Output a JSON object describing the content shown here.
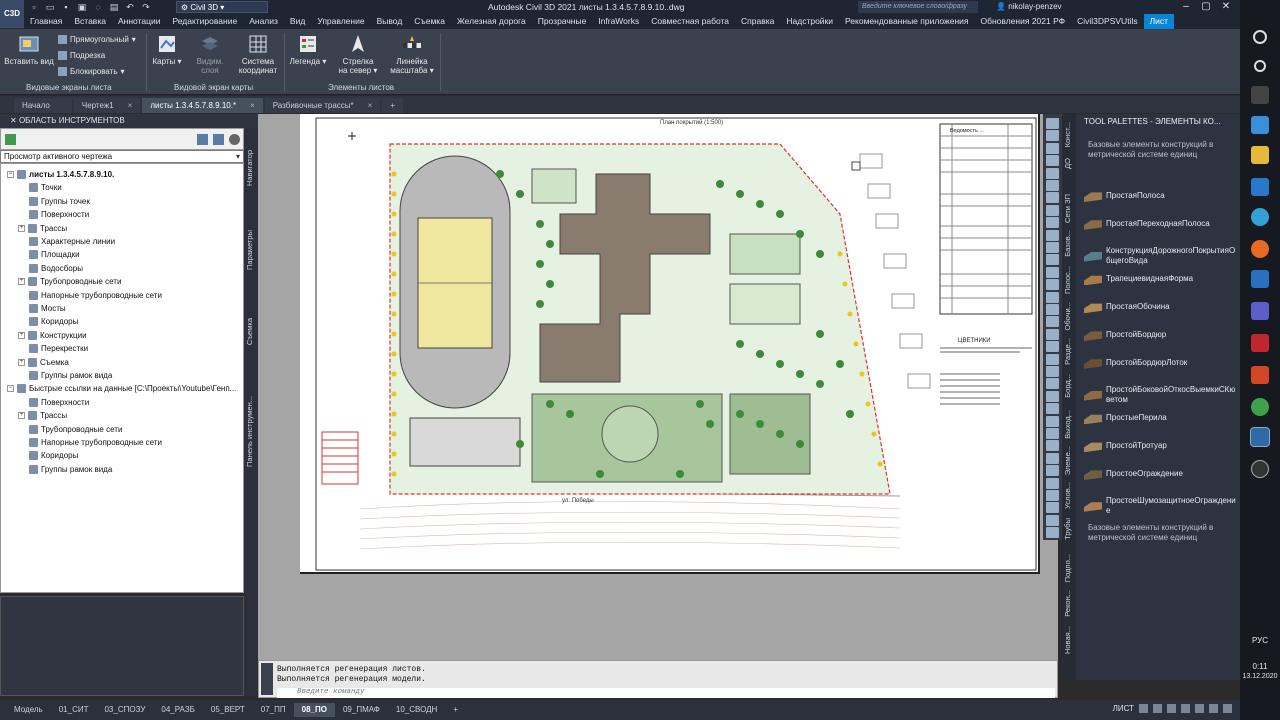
{
  "window": {
    "title": "Autodesk Civil 3D 2021   листы 1.3.4.5.7.8.9.10..dwg",
    "workspace": "Civil 3D",
    "search_placeholder": "Введите ключевое слово/фразу",
    "user": "nikolay-penzev",
    "logo": "C3D"
  },
  "menu": [
    "Главная",
    "Вставка",
    "Аннотации",
    "Редактирование",
    "Анализ",
    "Вид",
    "Управление",
    "Вывод",
    "Съемка",
    "Железная дорога",
    "Прозрачные",
    "InfraWorks",
    "Совместная работа",
    "Справка",
    "Надстройки",
    "Рекомендованные приложения",
    "Обновления 2021 РФ",
    "Civil3DPSVUtils",
    "Лист"
  ],
  "ribbon": {
    "insert_view": "Вставить вид",
    "rect": "Прямоугольный",
    "trim": "Подрезка",
    "lock": "Блокировать",
    "maps": "Карты",
    "visible_layers_1": "Видим.",
    "visible_layers_2": "слоя",
    "coord_sys_1": "Система",
    "coord_sys_2": "координат",
    "legend": "Легенда",
    "north_arrow_1": "Стрелка",
    "north_arrow_2": "на север",
    "scale_bar_1": "Линейка",
    "scale_bar_2": "масштаба",
    "panel_viewports": "Видовые экраны листа",
    "panel_map_viewport": "Видовой экран карты",
    "panel_sheet_elements": "Элементы листов"
  },
  "doc_tabs": [
    {
      "label": "Начало",
      "active": false,
      "close": ""
    },
    {
      "label": "Чертеж1",
      "active": false,
      "close": "×"
    },
    {
      "label": "листы 1.3.4.5.7.8.9.10.*",
      "active": true,
      "close": "×"
    },
    {
      "label": "Разбивочные трассы*",
      "active": false,
      "close": "×"
    }
  ],
  "toolspace": {
    "title": "ОБЛАСТЬ ИНСТРУМЕНТОВ",
    "view_select": "Просмотр активного чертежа",
    "tree": [
      {
        "label": "листы 1.3.4.5.7.8.9.10.",
        "level": 0,
        "exp": "−",
        "bold": true
      },
      {
        "label": "Точки",
        "level": 2,
        "exp": ""
      },
      {
        "label": "Группы точек",
        "level": 2,
        "exp": ""
      },
      {
        "label": "Поверхности",
        "level": 2,
        "exp": ""
      },
      {
        "label": "Трассы",
        "level": 1,
        "exp": "+"
      },
      {
        "label": "Характерные линии",
        "level": 2,
        "exp": ""
      },
      {
        "label": "Площадки",
        "level": 2,
        "exp": ""
      },
      {
        "label": "Водосборы",
        "level": 2,
        "exp": ""
      },
      {
        "label": "Трубопроводные сети",
        "level": 1,
        "exp": "+"
      },
      {
        "label": "Напорные трубопроводные сети",
        "level": 2,
        "exp": ""
      },
      {
        "label": "Мосты",
        "level": 2,
        "exp": ""
      },
      {
        "label": "Коридоры",
        "level": 2,
        "exp": ""
      },
      {
        "label": "Конструкции",
        "level": 1,
        "exp": "+"
      },
      {
        "label": "Перекрестки",
        "level": 2,
        "exp": ""
      },
      {
        "label": "Съемка",
        "level": 1,
        "exp": "+"
      },
      {
        "label": "Группы рамок вида",
        "level": 2,
        "exp": ""
      },
      {
        "label": "Быстрые ссылки на данные [C:\\Проекты\\Youtube\\Генп...",
        "level": 0,
        "exp": "−"
      },
      {
        "label": "Поверхности",
        "level": 2,
        "exp": ""
      },
      {
        "label": "Трассы",
        "level": 1,
        "exp": "+"
      },
      {
        "label": "Трубопроводные сети",
        "level": 2,
        "exp": ""
      },
      {
        "label": "Напорные трубопроводные сети",
        "level": 2,
        "exp": ""
      },
      {
        "label": "Коридоры",
        "level": 2,
        "exp": ""
      },
      {
        "label": "Группы рамок вида",
        "level": 2,
        "exp": ""
      }
    ],
    "side_tabs": [
      "Навигатор",
      "Параметры",
      "Съемка",
      "Панель инструмен..."
    ]
  },
  "drawing": {
    "plan_title": "План покрытий (1:500)",
    "street_label": "ул. Победы",
    "flowerbeds_title": "ЦВЕТНИКИ",
    "table_title": "Ведомость ..."
  },
  "command": {
    "line1": "Выполняется регенерация листов.",
    "line2": "Выполняется регенерация модели.",
    "placeholder": "Введите команду"
  },
  "palette": {
    "title": "TOOL PALETTES - ЭЛЕМЕНТЫ КО...",
    "desc_top": "Базовые элементы конструкций в метрической системе единиц",
    "desc_bottom": "Базовые элементы конструкций в метрической системе единиц",
    "items": [
      {
        "label": "ПростаяПолоса",
        "color": "#9b7a50"
      },
      {
        "label": "ПростаяПереходнаяПолоса",
        "color": "#8a6b45"
      },
      {
        "label": "КонструкцияДорожногоПокрытияОбщегоВида",
        "color": "#5a7c8f"
      },
      {
        "label": "ТрапециевиднаяФорма",
        "color": "#a87b4a"
      },
      {
        "label": "ПростаяОбочина",
        "color": "#b08a55"
      },
      {
        "label": "ПростойБордюр",
        "color": "#7a5b3c"
      },
      {
        "label": "ПростойБордюрЛоток",
        "color": "#6b4f35"
      },
      {
        "label": "ПростойБоковойОткосВыемкиСКюветом",
        "color": "#8c6a44"
      },
      {
        "label": "ПростыеПерила",
        "color": "#9c7f5b"
      },
      {
        "label": "ПростойТротуар",
        "color": "#a88a60"
      },
      {
        "label": "ПростоеОграждение",
        "color": "#705e40"
      },
      {
        "label": "ПростоеШумозащитноеОграждение",
        "color": "#b07a55"
      }
    ],
    "side_tabs": [
      "Конст...",
      "ДО",
      "Сети ЗП",
      "Базов...",
      "Полос...",
      "Обочи...",
      "Разде...",
      "Борд...",
      "Выход...",
      "Элеме...",
      "Услов...",
      "Трубы",
      "Подпо...",
      "Рекон...",
      "Новая..."
    ]
  },
  "layouts": [
    "Модель",
    "01_СИТ",
    "03_СПОЗУ",
    "04_РАЗБ",
    "05_ВЕРТ",
    "07_ПП",
    "08_ПО",
    "09_ПМАФ",
    "10_СВОДН",
    "+"
  ],
  "active_layout": "08_ПО",
  "status_label": "ЛИСТ",
  "taskbar": {
    "lang": "РУС",
    "time": "0:11",
    "date": "13.12.2020"
  }
}
